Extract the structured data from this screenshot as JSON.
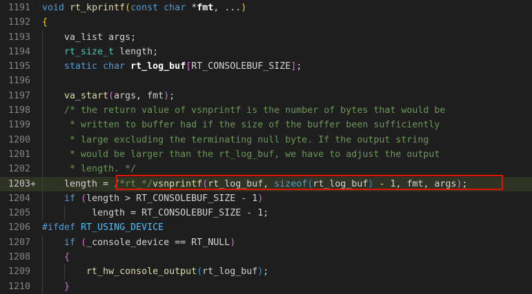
{
  "editor": {
    "colors": {
      "background": "#1e1e1e",
      "highlight_line": "#2f3324",
      "annotation_box": "#e51400"
    },
    "lines": [
      {
        "num": "1191",
        "marker": "",
        "highlight": false,
        "indent": 0,
        "tokens": [
          {
            "t": "void",
            "c": "kw"
          },
          {
            "t": " ",
            "c": "id"
          },
          {
            "t": "rt_kprintf",
            "c": "fn"
          },
          {
            "t": "(",
            "c": "br1"
          },
          {
            "t": "const",
            "c": "kw"
          },
          {
            "t": " ",
            "c": "id"
          },
          {
            "t": "char",
            "c": "kw"
          },
          {
            "t": " *",
            "c": "id"
          },
          {
            "t": "fmt",
            "c": "bold"
          },
          {
            "t": ", ...",
            "c": "id"
          },
          {
            "t": ")",
            "c": "br1"
          }
        ]
      },
      {
        "num": "1192",
        "marker": "",
        "highlight": false,
        "indent": 0,
        "tokens": [
          {
            "t": "{",
            "c": "br1"
          }
        ]
      },
      {
        "num": "1193",
        "marker": "",
        "highlight": false,
        "indent": 1,
        "tokens": [
          {
            "t": "    ",
            "c": "id"
          },
          {
            "t": "va_list args;",
            "c": "id"
          }
        ]
      },
      {
        "num": "1194",
        "marker": "",
        "highlight": false,
        "indent": 1,
        "tokens": [
          {
            "t": "    ",
            "c": "id"
          },
          {
            "t": "rt_size_t",
            "c": "ty"
          },
          {
            "t": " length;",
            "c": "id"
          }
        ]
      },
      {
        "num": "1195",
        "marker": "",
        "highlight": false,
        "indent": 1,
        "tokens": [
          {
            "t": "    ",
            "c": "id"
          },
          {
            "t": "static",
            "c": "kw"
          },
          {
            "t": " ",
            "c": "id"
          },
          {
            "t": "char",
            "c": "kw"
          },
          {
            "t": " ",
            "c": "id"
          },
          {
            "t": "rt_log_buf",
            "c": "bold"
          },
          {
            "t": "[",
            "c": "br2"
          },
          {
            "t": "RT_CONSOLEBUF_SIZE",
            "c": "id"
          },
          {
            "t": "]",
            "c": "br2"
          },
          {
            "t": ";",
            "c": "id"
          }
        ]
      },
      {
        "num": "1196",
        "marker": "",
        "highlight": false,
        "indent": 1,
        "tokens": []
      },
      {
        "num": "1197",
        "marker": "",
        "highlight": false,
        "indent": 1,
        "tokens": [
          {
            "t": "    ",
            "c": "id"
          },
          {
            "t": "va_start",
            "c": "fn"
          },
          {
            "t": "(",
            "c": "br2"
          },
          {
            "t": "args, fmt",
            "c": "id"
          },
          {
            "t": ")",
            "c": "br2"
          },
          {
            "t": ";",
            "c": "id"
          }
        ]
      },
      {
        "num": "1198",
        "marker": "",
        "highlight": false,
        "indent": 1,
        "tokens": [
          {
            "t": "    ",
            "c": "id"
          },
          {
            "t": "/* the return value of vsnprintf is the number of bytes that would be",
            "c": "cm"
          }
        ]
      },
      {
        "num": "1199",
        "marker": "",
        "highlight": false,
        "indent": 1,
        "tokens": [
          {
            "t": "    ",
            "c": "id"
          },
          {
            "t": " * written to buffer had if the size of the buffer been sufficiently",
            "c": "cm"
          }
        ]
      },
      {
        "num": "1200",
        "marker": "",
        "highlight": false,
        "indent": 1,
        "tokens": [
          {
            "t": "    ",
            "c": "id"
          },
          {
            "t": " * large excluding the terminating null byte. If the output string",
            "c": "cm"
          }
        ]
      },
      {
        "num": "1201",
        "marker": "",
        "highlight": false,
        "indent": 1,
        "tokens": [
          {
            "t": "    ",
            "c": "id"
          },
          {
            "t": " * would be larger than the rt_log_buf, we have to adjust the output",
            "c": "cm"
          }
        ]
      },
      {
        "num": "1202",
        "marker": "",
        "highlight": false,
        "indent": 1,
        "tokens": [
          {
            "t": "    ",
            "c": "id"
          },
          {
            "t": " * length. */",
            "c": "cm"
          }
        ]
      },
      {
        "num": "1203",
        "marker": "+",
        "highlight": true,
        "indent": 1,
        "tokens": [
          {
            "t": "    ",
            "c": "id"
          },
          {
            "t": "length = ",
            "c": "id"
          },
          {
            "t": "/*rt_*/",
            "c": "cm"
          },
          {
            "t": "vsnprintf",
            "c": "fn"
          },
          {
            "t": "(",
            "c": "br2"
          },
          {
            "t": "rt_log_buf, ",
            "c": "id"
          },
          {
            "t": "sizeof",
            "c": "kw"
          },
          {
            "t": "(",
            "c": "br3"
          },
          {
            "t": "rt_log_buf",
            "c": "id"
          },
          {
            "t": ")",
            "c": "br3"
          },
          {
            "t": " - 1, fmt, args",
            "c": "id"
          },
          {
            "t": ")",
            "c": "br2"
          },
          {
            "t": ";",
            "c": "id"
          }
        ]
      },
      {
        "num": "1204",
        "marker": "",
        "highlight": false,
        "indent": 1,
        "tokens": [
          {
            "t": "    ",
            "c": "id"
          },
          {
            "t": "if",
            "c": "kw"
          },
          {
            "t": " ",
            "c": "id"
          },
          {
            "t": "(",
            "c": "br2"
          },
          {
            "t": "length > RT_CONSOLEBUF_SIZE - 1",
            "c": "id"
          },
          {
            "t": ")",
            "c": "br2"
          }
        ]
      },
      {
        "num": "1205",
        "marker": "",
        "highlight": false,
        "indent": 2,
        "tokens": [
          {
            "t": "         ",
            "c": "id"
          },
          {
            "t": "length = RT_CONSOLEBUF_SIZE - 1;",
            "c": "id"
          }
        ]
      },
      {
        "num": "1206",
        "marker": "",
        "highlight": false,
        "indent": 0,
        "tokens": [
          {
            "t": "#ifdef",
            "c": "kw"
          },
          {
            "t": " ",
            "c": "id"
          },
          {
            "t": "RT_USING_DEVICE",
            "c": "mc"
          }
        ]
      },
      {
        "num": "1207",
        "marker": "",
        "highlight": false,
        "indent": 1,
        "tokens": [
          {
            "t": "    ",
            "c": "id"
          },
          {
            "t": "if",
            "c": "kw"
          },
          {
            "t": " ",
            "c": "id"
          },
          {
            "t": "(",
            "c": "br2"
          },
          {
            "t": "_console_device == RT_NULL",
            "c": "id"
          },
          {
            "t": ")",
            "c": "br2"
          }
        ]
      },
      {
        "num": "1208",
        "marker": "",
        "highlight": false,
        "indent": 1,
        "tokens": [
          {
            "t": "    ",
            "c": "id"
          },
          {
            "t": "{",
            "c": "br2"
          }
        ]
      },
      {
        "num": "1209",
        "marker": "",
        "highlight": false,
        "indent": 2,
        "tokens": [
          {
            "t": "        ",
            "c": "id"
          },
          {
            "t": "rt_hw_console_output",
            "c": "fn"
          },
          {
            "t": "(",
            "c": "br3"
          },
          {
            "t": "rt_log_buf",
            "c": "id"
          },
          {
            "t": ")",
            "c": "br3"
          },
          {
            "t": ";",
            "c": "id"
          }
        ]
      },
      {
        "num": "1210",
        "marker": "",
        "highlight": false,
        "indent": 1,
        "tokens": [
          {
            "t": "    ",
            "c": "id"
          },
          {
            "t": "}",
            "c": "br2"
          }
        ]
      }
    ]
  }
}
